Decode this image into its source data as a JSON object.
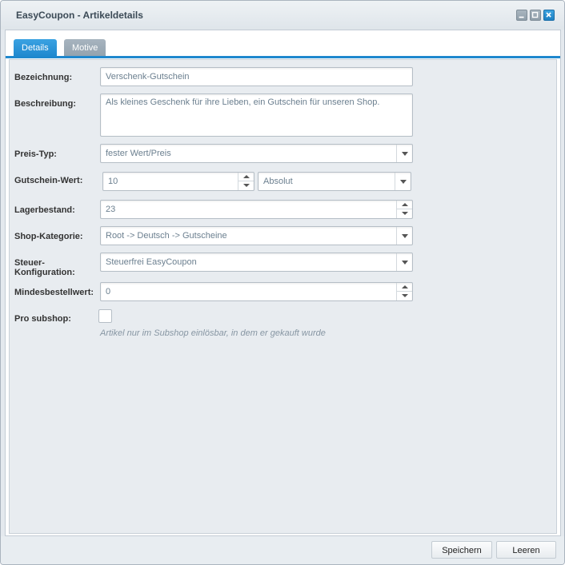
{
  "window": {
    "title": "EasyCoupon - Artikeldetails",
    "controls": [
      "minimize-icon",
      "maximize-icon",
      "close-icon"
    ]
  },
  "tabs": [
    {
      "label": "Details",
      "active": true
    },
    {
      "label": "Motive",
      "active": false
    }
  ],
  "form": {
    "bezeichnung": {
      "label": "Bezeichnung:",
      "value": "Verschenk-Gutschein"
    },
    "beschreibung": {
      "label": "Beschreibung:",
      "value": "Als kleines Geschenk für ihre Lieben, ein Gutschein für unseren Shop."
    },
    "preis_typ": {
      "label": "Preis-Typ:",
      "value": "fester Wert/Preis"
    },
    "gutschein_wert": {
      "label": "Gutschein-Wert:",
      "value": "10",
      "mode": "Absolut"
    },
    "lagerbestand": {
      "label": "Lagerbestand:",
      "value": "23"
    },
    "shop_kategorie": {
      "label": "Shop-Kategorie:",
      "value": "Root -> Deutsch -> Gutscheine"
    },
    "steuer": {
      "label_line1": "Steuer-",
      "label_line2": "Konfiguration:",
      "value": "Steuerfrei EasyCoupon"
    },
    "mindestbestellwert": {
      "label": "Mindesbestellwert:",
      "value": "0"
    },
    "pro_subshop": {
      "label": "Pro subshop:",
      "checked": false,
      "hint": "Artikel nur im Subshop einlösbar, in dem er gekauft wurde"
    }
  },
  "footer": {
    "save_label": "Speichern",
    "clear_label": "Leeren"
  },
  "colors": {
    "accent": "#1f88ce",
    "inactive_tab": "#93a2ae",
    "field_text": "#6b7f8f"
  }
}
